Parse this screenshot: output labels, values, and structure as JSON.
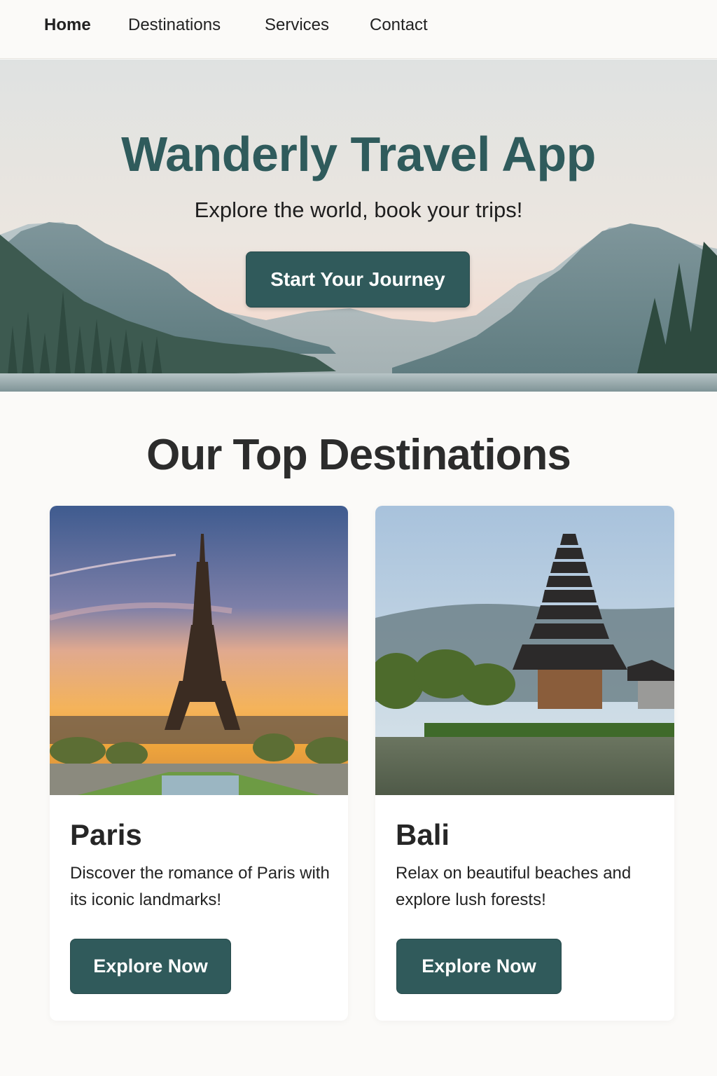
{
  "nav": {
    "items": [
      {
        "label": "Home",
        "active": true
      },
      {
        "label": "Destinations",
        "active": false
      },
      {
        "label": "Services",
        "active": false
      },
      {
        "label": "Contact",
        "active": false
      }
    ]
  },
  "hero": {
    "title": "Wanderly Travel App",
    "subtitle": "Explore the world, book your trips!",
    "cta_label": "Start Your Journey"
  },
  "destinations": {
    "heading": "Our Top Destinations",
    "cards": [
      {
        "name": "Paris",
        "description": "Discover the romance of Paris with its iconic landmarks!",
        "button_label": "Explore Now"
      },
      {
        "name": "Bali",
        "description": "Relax on beautiful beaches and explore lush forests!",
        "button_label": "Explore Now"
      }
    ]
  },
  "colors": {
    "primary": "#305a5b",
    "title_teal": "#2f5b5c",
    "page_background": "#fbfaf8",
    "text_dark": "#2c2c2c"
  }
}
